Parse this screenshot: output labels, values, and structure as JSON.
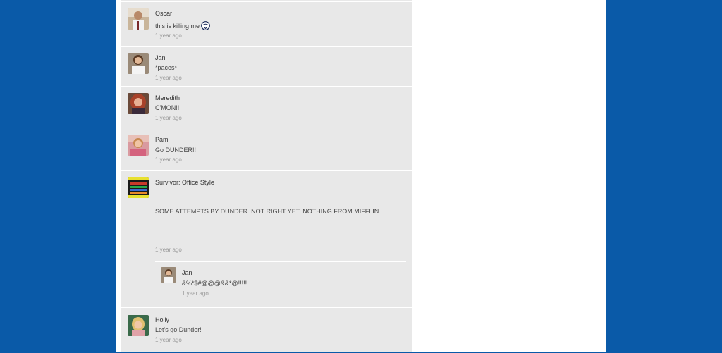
{
  "posts": [
    {
      "author": "Oscar",
      "text": "this is killing me",
      "time": "1 year ago",
      "icon": "reaction-emoji-icon"
    },
    {
      "author": "Jan",
      "text": "*paces*",
      "time": "1 year ago"
    },
    {
      "author": "Meredith",
      "text": "C'MON!!!",
      "time": "1 year ago"
    },
    {
      "author": "Pam",
      "text": "Go DUNDER!!",
      "time": "1 year ago"
    },
    {
      "author": "Survivor: Office Style",
      "text": "SOME ATTEMPTS BY DUNDER.  NOT RIGHT YET.  NOTHING FROM MIFFLIN...",
      "time": "1 year ago",
      "reply": {
        "author": "Jan",
        "text": "&%*$#@@@&&*@!!!!!",
        "time": "1 year ago"
      }
    },
    {
      "author": "Holly",
      "text": "Let's go Dunder!",
      "time": "1 year ago"
    }
  ],
  "colors": {
    "background": "#0a5aa8",
    "page": "#ffffff",
    "feed": "#e8e8e8"
  }
}
